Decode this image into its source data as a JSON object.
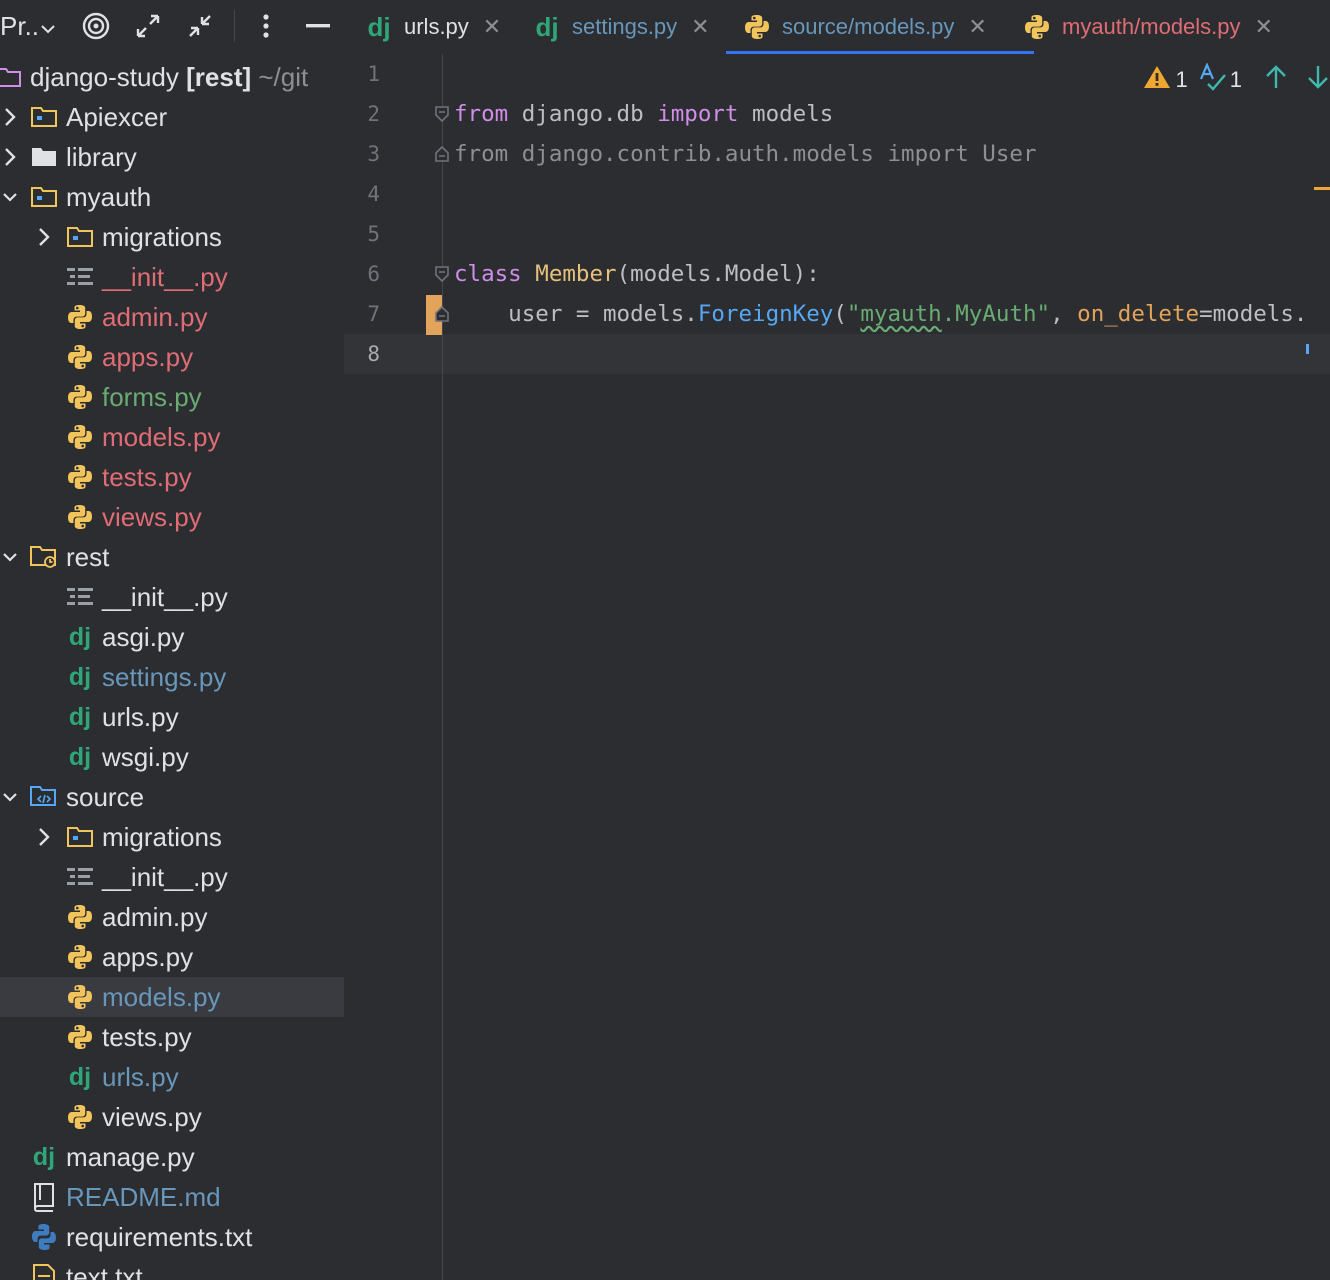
{
  "sidebar": {
    "title": "Pr..",
    "rows": [
      {
        "label": "django-study",
        "branch": "[rest]",
        "path": "~/git",
        "color": "#dfe1e5"
      },
      {
        "label": "Apiexcer",
        "color": "#dfe1e5"
      },
      {
        "label": "library",
        "color": "#dfe1e5"
      },
      {
        "label": "myauth",
        "color": "#dfe1e5"
      },
      {
        "label": "migrations",
        "color": "#dfe1e5"
      },
      {
        "label": "__init__.py",
        "color": "#e06c75"
      },
      {
        "label": "admin.py",
        "color": "#e06c75"
      },
      {
        "label": "apps.py",
        "color": "#e06c75"
      },
      {
        "label": "forms.py",
        "color": "#6aab73"
      },
      {
        "label": "models.py",
        "color": "#e06c75"
      },
      {
        "label": "tests.py",
        "color": "#e06c75"
      },
      {
        "label": "views.py",
        "color": "#e06c75"
      },
      {
        "label": "rest",
        "color": "#dfe1e5"
      },
      {
        "label": "__init__.py",
        "color": "#dfe1e5"
      },
      {
        "label": "asgi.py",
        "color": "#dfe1e5"
      },
      {
        "label": "settings.py",
        "color": "#6897bb"
      },
      {
        "label": "urls.py",
        "color": "#dfe1e5"
      },
      {
        "label": "wsgi.py",
        "color": "#dfe1e5"
      },
      {
        "label": "source",
        "color": "#dfe1e5"
      },
      {
        "label": "migrations",
        "color": "#dfe1e5"
      },
      {
        "label": "__init__.py",
        "color": "#dfe1e5"
      },
      {
        "label": "admin.py",
        "color": "#dfe1e5"
      },
      {
        "label": "apps.py",
        "color": "#dfe1e5"
      },
      {
        "label": "models.py",
        "color": "#6897bb"
      },
      {
        "label": "tests.py",
        "color": "#dfe1e5"
      },
      {
        "label": "urls.py",
        "color": "#6897bb"
      },
      {
        "label": "views.py",
        "color": "#dfe1e5"
      },
      {
        "label": "manage.py",
        "color": "#dfe1e5"
      },
      {
        "label": "README.md",
        "color": "#6897bb"
      },
      {
        "label": "requirements.txt",
        "color": "#dfe1e5"
      },
      {
        "label": "text.txt",
        "color": "#dfe1e5"
      }
    ]
  },
  "tabs": [
    {
      "label": "urls.py",
      "color": "#dfe1e5"
    },
    {
      "label": "settings.py",
      "color": "#6897bb"
    },
    {
      "label": "source/models.py",
      "color": "#6897bb"
    },
    {
      "label": "myauth/models.py",
      "color": "#e06c75"
    }
  ],
  "editor": {
    "line_numbers": [
      "1",
      "2",
      "3",
      "4",
      "5",
      "6",
      "7",
      "8"
    ],
    "warnings": "1",
    "typos": "1",
    "code": {
      "l2": {
        "kw1": "from",
        "mod": " django.db ",
        "kw2": "import",
        "name": " models"
      },
      "l3": "from django.contrib.auth.models import User",
      "l6": {
        "kw": "class",
        "cls": " Member",
        "rest": "(models.Model):"
      },
      "l7": {
        "indent": "    user = models.",
        "fn": "ForeignKey",
        "open": "(",
        "q1": "\"",
        "s1": "myauth",
        ".MyAuth\"": "",
        "s2": ".MyAuth\"",
        "sep": ", ",
        "prm": "on_delete",
        "tail": "=models."
      }
    }
  },
  "colors": {
    "accent": "#3574f0",
    "warning": "#f0a732",
    "django": "#2fa678",
    "python_yellow": "#f2c55c"
  }
}
